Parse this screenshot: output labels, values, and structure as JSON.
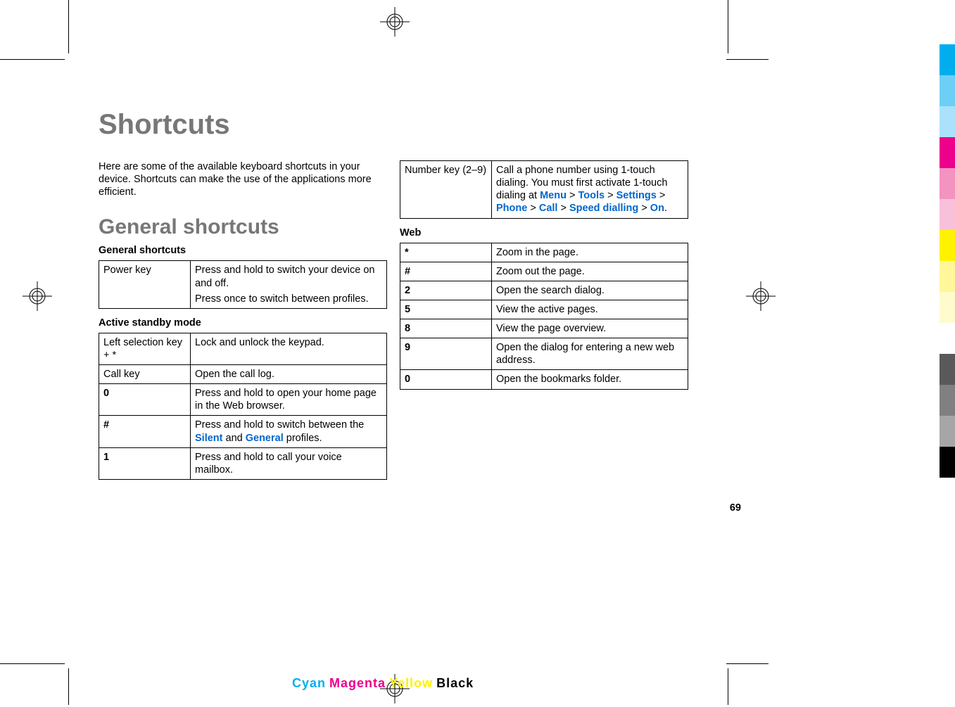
{
  "page": {
    "title": "Shortcuts",
    "intro": "Here are some of the available keyboard shortcuts in your device. Shortcuts can make the use of the applications more efficient.",
    "section_heading": "General shortcuts",
    "page_number": "69"
  },
  "tables": {
    "general": {
      "title": "General shortcuts",
      "rows": [
        {
          "key": "Power key",
          "desc1": "Press and hold to switch your device on and off.",
          "desc2": "Press once to switch between profiles."
        }
      ]
    },
    "standby": {
      "title": "Active standby mode",
      "rows": [
        {
          "key": "Left selection key + *",
          "desc": "Lock and unlock the keypad."
        },
        {
          "key": "Call key",
          "desc": "Open the call log."
        },
        {
          "key": "0",
          "desc": "Press and hold to open your home page in the Web browser."
        },
        {
          "key": "#",
          "desc_prefix": "Press and hold to switch between the ",
          "hl1": "Silent",
          "mid": " and ",
          "hl2": "General",
          "suffix": " profiles."
        },
        {
          "key": "1",
          "desc": "Press and hold to call your voice mailbox."
        },
        {
          "key": "Number key (2–9)",
          "desc_prefix": "Call a phone number using 1-touch dialing. You must first activate 1-touch dialing at ",
          "path": [
            "Menu",
            "Tools",
            "Settings",
            "Phone",
            "Call",
            "Speed dialling",
            "On"
          ]
        }
      ]
    },
    "web": {
      "title": "Web",
      "rows": [
        {
          "key": "*",
          "desc": "Zoom in the page."
        },
        {
          "key": "#",
          "desc": "Zoom out the page."
        },
        {
          "key": "2",
          "desc": "Open the search dialog."
        },
        {
          "key": "5",
          "desc": "View the active pages."
        },
        {
          "key": "8",
          "desc": "View the page overview."
        },
        {
          "key": "9",
          "desc": "Open the dialog for entering a new web address."
        },
        {
          "key": "0",
          "desc": "Open the bookmarks folder."
        }
      ]
    }
  },
  "footer": {
    "cyan": "Cyan",
    "magenta": "Magenta",
    "yellow": "Yellow",
    "black": "Black"
  },
  "sep": " > "
}
